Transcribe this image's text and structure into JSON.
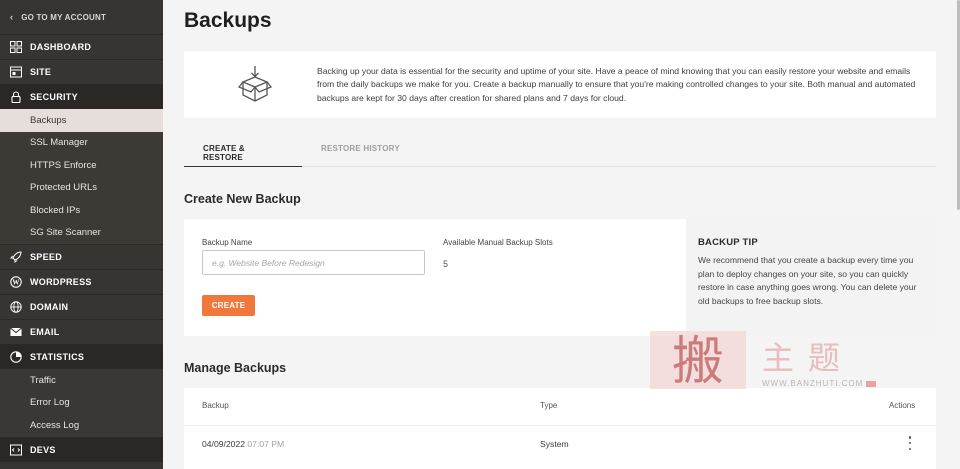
{
  "sidebar": {
    "back_label": "GO TO MY ACCOUNT",
    "sections": {
      "dashboard": "DASHBOARD",
      "site": "SITE",
      "security": "SECURITY",
      "speed": "SPEED",
      "wordpress": "WORDPRESS",
      "domain": "DOMAIN",
      "email": "EMAIL",
      "statistics": "STATISTICS",
      "devs": "DEVS"
    },
    "security_items": [
      "Backups",
      "SSL Manager",
      "HTTPS Enforce",
      "Protected URLs",
      "Blocked IPs",
      "SG Site Scanner"
    ],
    "statistics_items": [
      "Traffic",
      "Error Log",
      "Access Log"
    ]
  },
  "page": {
    "title": "Backups",
    "intro": "Backing up your data is essential for the security and uptime of your site. Have a peace of mind knowing that you can easily restore your website and emails from the daily backups we make for you. Create a backup manually to ensure that you're making controlled changes to your site. Both manual and automated backups are kept for 30 days after creation for shared plans and 7 days for cloud."
  },
  "tabs": [
    "CREATE & RESTORE",
    "RESTORE HISTORY"
  ],
  "create": {
    "section_title": "Create New Backup",
    "name_label": "Backup Name",
    "name_placeholder": "e.g. Website Before Redesign",
    "slots_label": "Available Manual Backup Slots",
    "slots_value": "5",
    "button": "CREATE",
    "tip_title": "BACKUP TIP",
    "tip_text": "We recommend that you create a backup every time you plan to deploy changes on your site, so you can quickly restore in case anything goes wrong. You can delete your old backups to free backup slots."
  },
  "manage": {
    "section_title": "Manage Backups",
    "columns": [
      "Backup",
      "Type",
      "Actions"
    ],
    "rows": [
      {
        "date": "04/09/2022",
        "time": "07:07 PM",
        "type": "System"
      }
    ]
  },
  "watermark": {
    "seal_text": "搬",
    "chars": "主题",
    "url": "WWW.BANZHUTI.COM"
  },
  "colors": {
    "sidebar_bg": "#383431",
    "accent": "#f1783c",
    "selected_item_bg": "#e6dedb"
  }
}
